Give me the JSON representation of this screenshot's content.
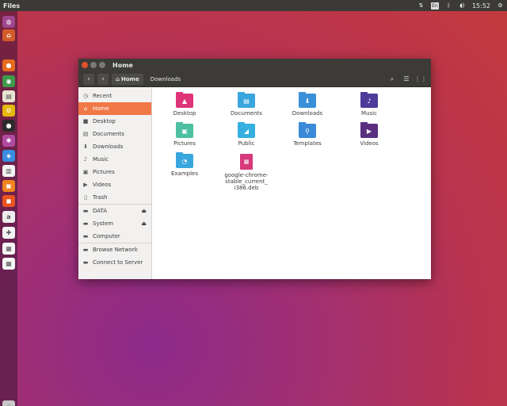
{
  "top_panel": {
    "app_title": "Files",
    "keyboard_badge": "En",
    "clock": "15:52"
  },
  "launcher": {
    "items": [
      {
        "icon": "dash-icon",
        "color": "#a0468e",
        "glyph": "◍"
      },
      {
        "icon": "home-folder-icon",
        "color": "#d45c2a",
        "glyph": "⌂"
      },
      {
        "icon": "firefox-icon",
        "color": "#e66a20",
        "glyph": "●"
      },
      {
        "icon": "chrome-icon",
        "color": "#3e9a4a",
        "glyph": "◉"
      },
      {
        "icon": "files-icon",
        "color": "#e8e3d3",
        "glyph": "▤"
      },
      {
        "icon": "settings-icon",
        "color": "#e5b80c",
        "glyph": "⚙"
      },
      {
        "icon": "terminal-icon",
        "color": "#2b2b2b",
        "glyph": "●"
      },
      {
        "icon": "system-settings-icon",
        "color": "#b04aa0",
        "glyph": "✱"
      },
      {
        "icon": "browser-icon",
        "color": "#3a8de0",
        "glyph": "◈"
      },
      {
        "icon": "writer-icon",
        "color": "#f3f3f3",
        "glyph": "▥"
      },
      {
        "icon": "software-center-icon",
        "color": "#f0831e",
        "glyph": "▣"
      },
      {
        "icon": "app-store-icon",
        "color": "#e95420",
        "glyph": "◼"
      },
      {
        "icon": "amazon-icon",
        "color": "#ededed",
        "glyph": "a"
      },
      {
        "icon": "apps-icon",
        "color": "#f3f3f3",
        "glyph": "✚"
      },
      {
        "icon": "document-icon",
        "color": "#f5f5f5",
        "glyph": "▦"
      },
      {
        "icon": "document-2-icon",
        "color": "#f5f5f5",
        "glyph": "▦"
      },
      {
        "icon": "trash-icon",
        "color": "#c9c9c9",
        "glyph": "◌"
      }
    ]
  },
  "window": {
    "title": "Home",
    "breadcrumbs": [
      {
        "label": "Home",
        "active": true
      },
      {
        "label": "Downloads",
        "active": false
      }
    ]
  },
  "sidebar": {
    "places": [
      {
        "label": "Recent",
        "icon": "clock-icon",
        "glyph": "◷",
        "selected": false
      },
      {
        "label": "Home",
        "icon": "home-icon",
        "glyph": "⌂",
        "selected": true
      },
      {
        "label": "Desktop",
        "icon": "desktop-icon",
        "glyph": "■",
        "selected": false
      },
      {
        "label": "Documents",
        "icon": "documents-icon",
        "glyph": "▤",
        "selected": false
      },
      {
        "label": "Downloads",
        "icon": "downloads-icon",
        "glyph": "⬇",
        "selected": false
      },
      {
        "label": "Music",
        "icon": "music-icon",
        "glyph": "♪",
        "selected": false
      },
      {
        "label": "Pictures",
        "icon": "pictures-icon",
        "glyph": "▣",
        "selected": false
      },
      {
        "label": "Videos",
        "icon": "videos-icon",
        "glyph": "▶",
        "selected": false
      },
      {
        "label": "Trash",
        "icon": "trash-icon",
        "glyph": "▯",
        "selected": false
      }
    ],
    "devices": [
      {
        "label": "DATA",
        "icon": "drive-icon",
        "glyph": "▬",
        "eject": "⏏"
      },
      {
        "label": "System",
        "icon": "drive-icon",
        "glyph": "▬",
        "eject": "⏏"
      },
      {
        "label": "Computer",
        "icon": "computer-icon",
        "glyph": "▬",
        "eject": ""
      }
    ],
    "network": [
      {
        "label": "Browse Network",
        "icon": "network-icon",
        "glyph": "▬"
      },
      {
        "label": "Connect to Server",
        "icon": "server-icon",
        "glyph": "▬"
      }
    ]
  },
  "files": [
    {
      "name": "Desktop",
      "icon": "desktop-folder-icon",
      "color": "#e0347a",
      "glyph": "▲"
    },
    {
      "name": "Documents",
      "icon": "documents-folder-icon",
      "color": "#3aa6de",
      "glyph": "▤"
    },
    {
      "name": "Downloads",
      "icon": "downloads-folder-icon",
      "color": "#3a90d8",
      "glyph": "⬇"
    },
    {
      "name": "Music",
      "icon": "music-folder-icon",
      "color": "#4e3b9a",
      "glyph": "♪"
    },
    {
      "name": "Pictures",
      "icon": "pictures-folder-icon",
      "color": "#4cc0a0",
      "glyph": "▣"
    },
    {
      "name": "Public",
      "icon": "public-folder-icon",
      "color": "#35b0e0",
      "glyph": "◢"
    },
    {
      "name": "Templates",
      "icon": "templates-folder-icon",
      "color": "#3a8ad8",
      "glyph": "⚲"
    },
    {
      "name": "Videos",
      "icon": "videos-folder-icon",
      "color": "#5a2f80",
      "glyph": "▶"
    },
    {
      "name": "Examples",
      "icon": "examples-folder-icon",
      "color": "#3aa6de",
      "glyph": "◔"
    },
    {
      "name": "google-chrome-stable_current_i386.deb",
      "display": "google-chrome-\nstable_current_\ni386.deb",
      "icon": "deb-package-icon",
      "color": "#d63a7a",
      "glyph": "▦"
    }
  ]
}
